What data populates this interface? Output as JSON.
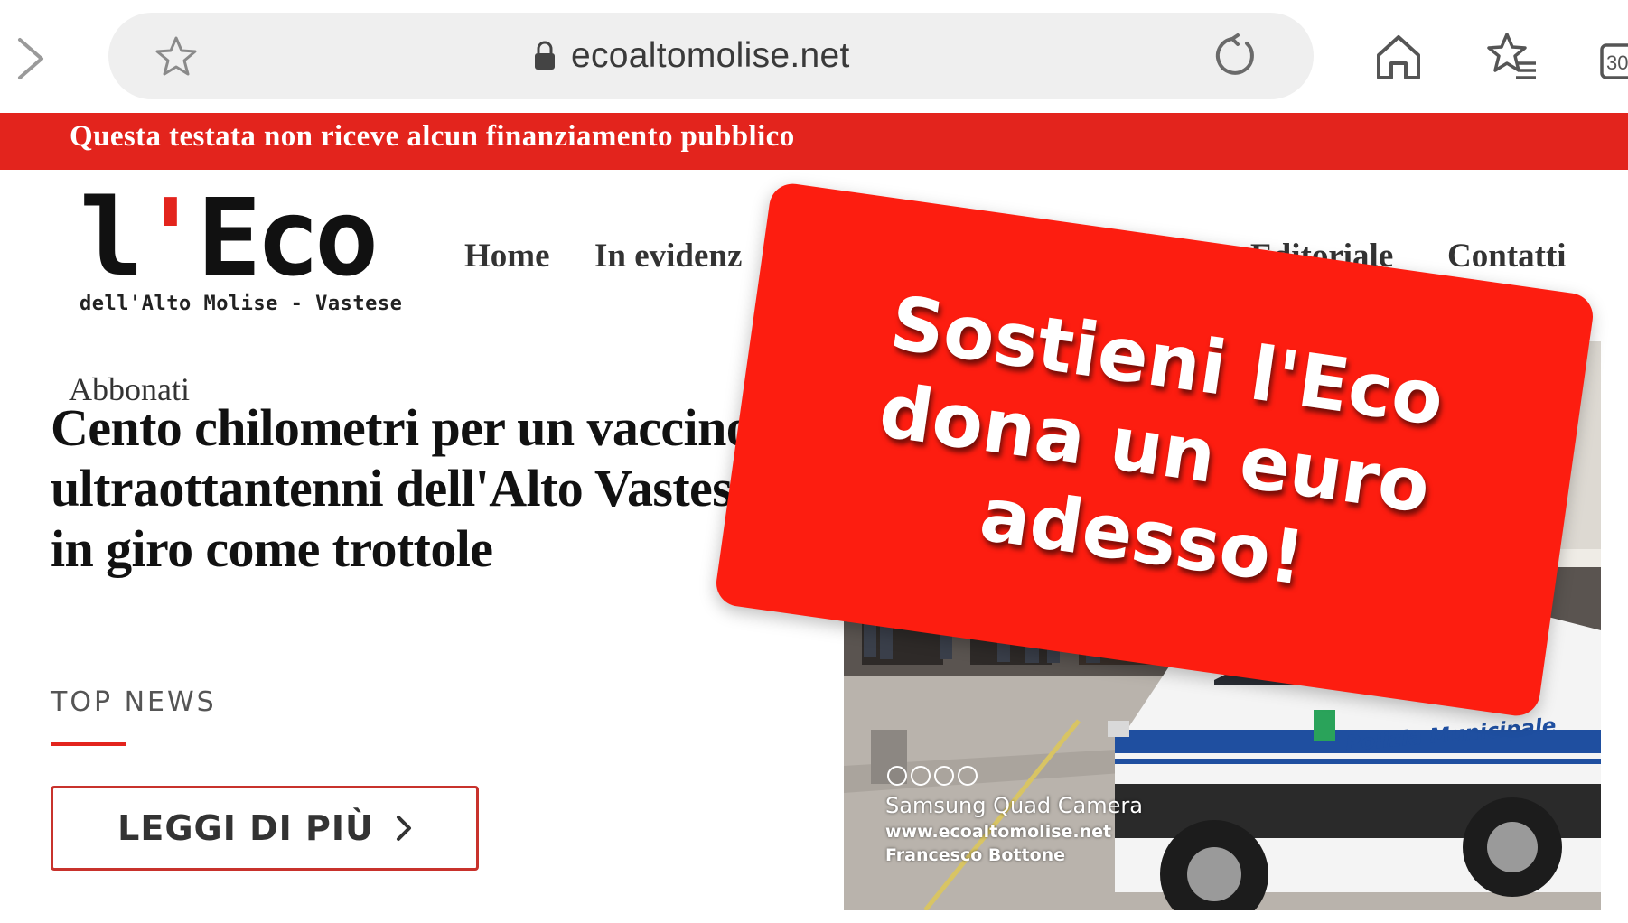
{
  "browser": {
    "url": "ecoaltomolise.net",
    "icons": {
      "forward": "chevron-right-icon",
      "bookmark": "star-icon",
      "lock": "lock-icon",
      "reload": "reload-icon",
      "home": "home-icon",
      "favorites": "favorites-list-icon",
      "tabs": "tabs-icon"
    },
    "tab_count": "30"
  },
  "banner": {
    "text": "Questa testata non riceve alcun finanziamento pubblico",
    "color": "#e3241d"
  },
  "site": {
    "logo_main": "l",
    "logo_apos": "'",
    "logo_tail": "Eco",
    "logo_sub": "dell'Alto Molise - Vastese",
    "nav": {
      "home": "Home",
      "evidenza": "In evidenz",
      "editoriale": "Editoriale",
      "contatti": "Contatti"
    }
  },
  "article": {
    "category": "Abbonati",
    "headline": "Cento chilometri per un vaccino, ultraottantenni dell'Alto Vastese in giro come trottole",
    "section_label": "TOP NEWS",
    "read_more": "LEGGI DI PIÙ"
  },
  "photo": {
    "watermark_camera": "Samsung Quad Camera",
    "watermark_site": "www.ecoaltomolise.net",
    "watermark_author": "Francesco Bottone",
    "car_label": "Polizia Municipale"
  },
  "donate": {
    "line1": "Sostieni l'Eco",
    "line2": "dona un euro",
    "line3": "adesso!",
    "color": "#fd1d10"
  }
}
